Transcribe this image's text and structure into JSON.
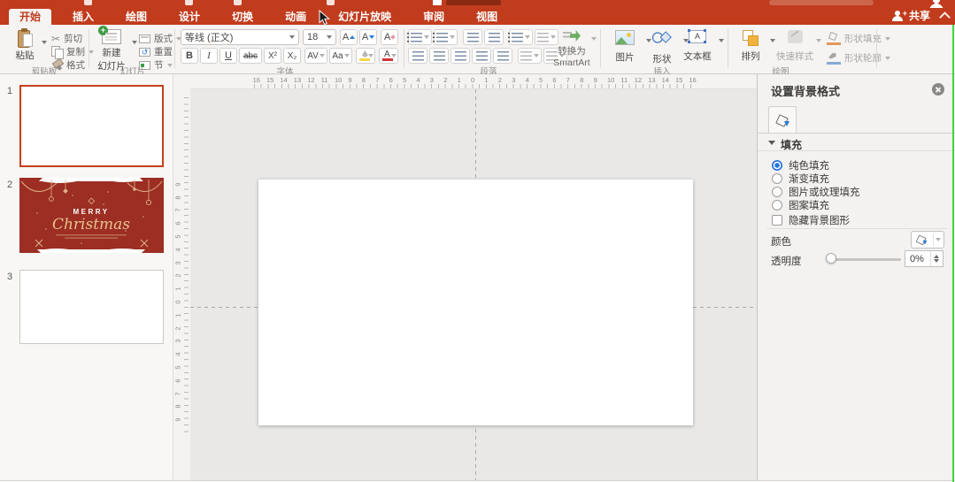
{
  "colors": {
    "ribbon_red": "#c13b1d",
    "accent_blue": "#2673e0",
    "selection_red": "#c4401c",
    "slide2_red": "#9c2e23",
    "slide2_gold": "#dcb287",
    "guide_line_green": "#3fd93f"
  },
  "titlebar": {
    "tabs": [
      {
        "label": "开始",
        "selected": true
      },
      {
        "label": "插入",
        "selected": false
      },
      {
        "label": "绘图",
        "selected": false
      },
      {
        "label": "设计",
        "selected": false
      },
      {
        "label": "切换",
        "selected": false
      },
      {
        "label": "动画",
        "selected": false
      },
      {
        "label": "幻灯片放映",
        "selected": false
      },
      {
        "label": "审阅",
        "selected": false
      },
      {
        "label": "视图",
        "selected": false
      }
    ],
    "share_label": "共享"
  },
  "ribbon": {
    "clipboard": {
      "group_label": "剪贴板",
      "paste": "粘贴",
      "cut": "剪切",
      "copy": "复制",
      "format_painter": "格式",
      "cut_icon": "✂"
    },
    "slides": {
      "group_label": "幻灯片",
      "new_slide_line1": "新建",
      "new_slide_line2": "幻灯片",
      "layout": "版式",
      "reset": "重置",
      "reset_icon": "↺",
      "section": "节"
    },
    "font": {
      "group_label": "字体",
      "font_name": "等线 (正文)",
      "font_size": "18",
      "bold": "B",
      "italic": "I",
      "underline": "U",
      "strikethrough": "abc",
      "superscript": "X²",
      "subscript": "X₂",
      "char_spacing": "AV",
      "change_case": "Aa",
      "grow_shrink_letter": "A",
      "font_color_letter": "A"
    },
    "paragraph": {
      "group_label": "段落",
      "smartart_line1": "转换为",
      "smartart_line2": "SmartArt"
    },
    "insert": {
      "group_label": "插入",
      "picture": "图片",
      "shapes": "形状",
      "textbox": "文本框"
    },
    "draw": {
      "group_label": "绘图",
      "arrange": "排列",
      "quick_styles": "快速样式",
      "shape_fill": "形状填充",
      "shape_outline": "形状轮廓"
    }
  },
  "thumbnails": {
    "slides": [
      {
        "num": "1"
      },
      {
        "num": "2",
        "title_line1": "MERRY",
        "title_line2": "Christmas"
      },
      {
        "num": "3"
      }
    ]
  },
  "rulers": {
    "h": [
      16,
      15,
      14,
      13,
      12,
      11,
      10,
      9,
      8,
      7,
      6,
      5,
      4,
      3,
      2,
      1,
      0,
      1,
      2,
      3,
      4,
      5,
      6,
      7,
      8,
      9,
      10,
      11,
      12,
      13,
      14,
      15,
      16
    ],
    "v": [
      9,
      8,
      7,
      6,
      5,
      4,
      3,
      2,
      1,
      0,
      1,
      2,
      3,
      4,
      5,
      6,
      7,
      8,
      9
    ]
  },
  "panel": {
    "title": "设置背景格式",
    "fill_section": "填充",
    "options": [
      {
        "label": "纯色填充",
        "selected": true
      },
      {
        "label": "渐变填充",
        "selected": false
      },
      {
        "label": "图片或纹理填充",
        "selected": false
      },
      {
        "label": "图案填充",
        "selected": false
      }
    ],
    "hide_bg": "隐藏背景图形",
    "color_label": "颜色",
    "transparency_label": "透明度",
    "transparency_value": "0%"
  }
}
